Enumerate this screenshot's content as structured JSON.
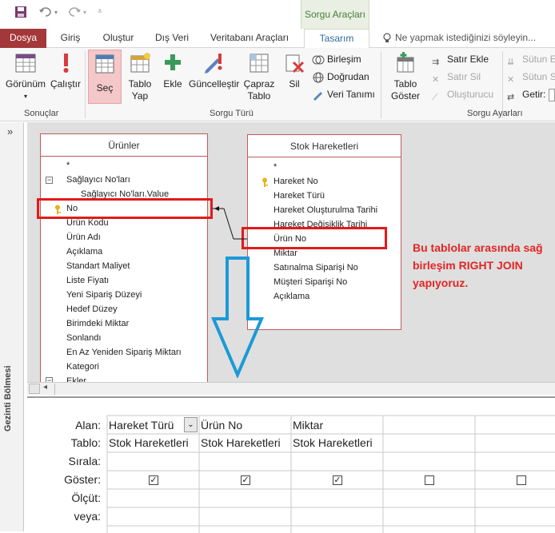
{
  "titlebar": {
    "contextual_tab": "Sorgu Araçları"
  },
  "tabs": [
    "Dosya",
    "Giriş",
    "Oluştur",
    "Dış Veri",
    "Veritabanı Araçları",
    "Tasarım"
  ],
  "tell_me": "Ne yapmak istediğinizi söyleyin...",
  "ribbon": {
    "results": {
      "view": "Görünüm",
      "run": "Çalıştır",
      "group": "Sonuçlar"
    },
    "query_type": {
      "select": "Seç",
      "make_table_1": "Tablo",
      "make_table_2": "Yap",
      "append": "Ekle",
      "update": "Güncelleştir",
      "crosstab_1": "Çapraz",
      "crosstab_2": "Tablo",
      "delete": "Sil",
      "union": "Birleşim",
      "passthrough": "Doğrudan",
      "data_definition": "Veri Tanımı",
      "group": "Sorgu Türü"
    },
    "setup": {
      "show_table_1": "Tablo",
      "show_table_2": "Göster",
      "insert_rows": "Satır Ekle",
      "delete_rows": "Satır Sil",
      "builder": "Oluşturucu",
      "insert_columns": "Sütun Ek",
      "delete_columns": "Sütun S",
      "return": "Getir:",
      "group": "Sorgu Ayarları"
    }
  },
  "nav_pane": {
    "label": "Gezinti Bölmesi",
    "toggle": "»"
  },
  "tables": {
    "urunler": {
      "title": "Ürünler",
      "fields": [
        "*",
        "Sağlayıcı No'ları",
        "Sağlayıcı No'ları.Value",
        "No",
        "Ürün Kodu",
        "Ürün Adı",
        "Açıklama",
        "Standart Maliyet",
        "Liste Fiyatı",
        "Yeni Sipariş Düzeyi",
        "Hedef Düzey",
        "Birimdeki Miktar",
        "Sonlandı",
        "En Az Yeniden Sipariş Miktarı",
        "Kategori",
        "Ekler"
      ]
    },
    "stok": {
      "title": "Stok Hareketleri",
      "fields": [
        "*",
        "Hareket No",
        "Hareket Türü",
        "Hareket Oluşturulma Tarihi",
        "Hareket Değişiklik Tarihi",
        "Ürün No",
        "Miktar",
        "Satınalma Siparişi No",
        "Müşteri Siparişi No",
        "Açıklama"
      ]
    }
  },
  "annotation": "Bu tablolar arasında sağ birleşim RIGHT JOIN yapıyoruz.",
  "grid": {
    "row_labels": [
      "Alan:",
      "Tablo:",
      "Sırala:",
      "Göster:",
      "Ölçüt:",
      "veya:"
    ],
    "columns": [
      {
        "field": "Hareket Türü",
        "table": "Stok Hareketleri",
        "show": true
      },
      {
        "field": "Ürün No",
        "table": "Stok Hareketleri",
        "show": true
      },
      {
        "field": "Miktar",
        "table": "Stok Hareketleri",
        "show": true
      },
      {
        "field": "",
        "table": "",
        "show": false
      },
      {
        "field": "",
        "table": "",
        "show": false
      }
    ],
    "dropdown_icon": "chevron-down-icon"
  }
}
